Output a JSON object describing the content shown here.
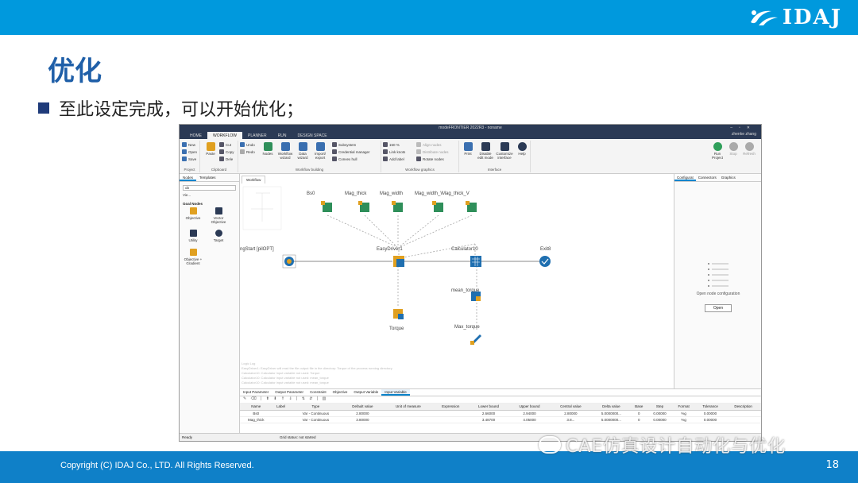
{
  "brand": {
    "logo_text": "IDAJ",
    "accent": "#0099dd"
  },
  "slide": {
    "title": "优化",
    "bullet": "至此设定完成，可以开始优化；",
    "copyright": "Copyright (C) IDAJ Co., LTD. All Rights Reserved.",
    "page_number": "18",
    "watermark": "CAE仿真设计自动化与优化"
  },
  "app": {
    "window_title": "modeFRONTIER 2022R3 - noname",
    "tabs": [
      "HOME",
      "WORKFLOW",
      "PLANNER",
      "RUN",
      "DESIGN SPACE"
    ],
    "active_tab": "WORKFLOW",
    "user": "zhenke zhang",
    "ribbon": {
      "project": {
        "label": "Project",
        "new": "New",
        "open": "Open",
        "save": "Save"
      },
      "clipboard": {
        "label": "Clipboard",
        "paste": "Paste",
        "cut": "Cut",
        "copy": "Copy",
        "delete": "Dele"
      },
      "wfb": {
        "label": "Workflow building",
        "undo": "Undo",
        "redo": "Redo",
        "nodes": "Nodes",
        "wizard": "Workflow wizard",
        "data": "Data wizard",
        "import": "Import/ export",
        "subsystem": "Subsystem",
        "credential": "Credential manager",
        "convex": "Convex hull"
      },
      "graphics": {
        "label": "Workflow graphics",
        "zoom": "150",
        "unit": "%",
        "link": "Link knots",
        "label_btn": "Add label",
        "align": "Align nodes",
        "distribute": "Distribute nodes",
        "rotate": "Rotate nodes"
      },
      "interface": {
        "label": "Interface",
        "print": "Print",
        "disable": "Disable edit mode",
        "customize": "Customize interface",
        "help": "Help"
      },
      "run": {
        "run": "Run Project",
        "stop": "Stop",
        "refresh": "Refresh"
      }
    },
    "left_panel": {
      "tabs": [
        "Nodes",
        "Templates"
      ],
      "search": "ob",
      "filter": "Vie...",
      "group": "Goal Nodes",
      "nodes": [
        "Objective",
        "Vector Objective",
        "Utility",
        "Target",
        "Objective + Gradient"
      ]
    },
    "canvas": {
      "tab": "Workflow",
      "labels": {
        "bs0": "Bs0",
        "mag_thick": "Mag_thick",
        "mag_width": "Mag_width",
        "mag_wt": "Mag_width_\\Mag_thick_V",
        "start": "ngStart [pilOPT]",
        "easydriver": "EasyDriver1",
        "calculator": "Calculator10",
        "exit": "Exit8",
        "mean_torque": "mean_torque",
        "torque": "Torque",
        "max_torque": "Max_torque"
      },
      "log": [
        "Logic Log",
        "EasyDriver1: EasyDriver will read the file output file in the directory: Torque of the process running directory.",
        "Calculator10: Calculator input variable not used: Torque",
        "Calculator10: Calculator input variable not used: mean_torque",
        "Calculator10: Calculator input variable not used: mean_torque"
      ]
    },
    "right_panel": {
      "tabs": [
        "Configurat",
        "Connectors",
        "Graphics"
      ],
      "message": "Open node configuration",
      "button": "Open"
    },
    "bottom_panel": {
      "tabs": [
        "Input Parameter",
        "Output Parameter",
        "Constraint",
        "Objective",
        "Output Variable",
        "Input Variable"
      ],
      "active": "Input Variable",
      "columns": [
        "Name",
        "Label",
        "Type",
        "Default value",
        "Unit of measure",
        "Expression",
        "Lower bound",
        "Upper bound",
        "Central value",
        "Delta value",
        "Base",
        "Step",
        "Format",
        "Tolerance",
        "Description"
      ],
      "rows": [
        [
          "Bs0",
          "",
          "Var - Continuous",
          "2.80000",
          "",
          "",
          "2.66000",
          "2.94000",
          "2.80000",
          "5.0000000...",
          "0",
          "0.00000",
          "%g",
          "0.00000",
          ""
        ],
        [
          "Mag_thick",
          "",
          "Var - Continuous",
          "3.80000",
          "",
          "",
          "3.48700",
          "4.05000",
          "3.8...",
          "5.0000000...",
          "0",
          "0.00000",
          "%g",
          "0.00000",
          ""
        ]
      ]
    },
    "status": {
      "left": "Ready",
      "grid": "Grid status: not started"
    }
  }
}
